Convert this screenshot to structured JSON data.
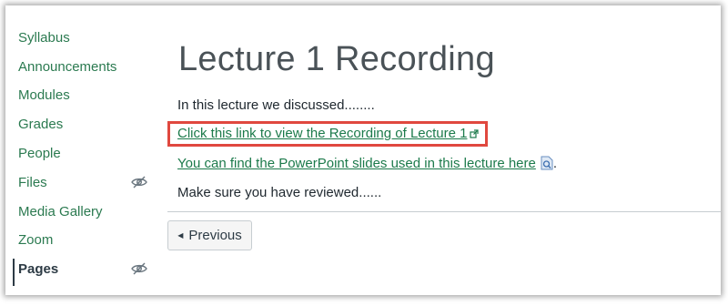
{
  "sidebar": {
    "items": [
      {
        "label": "Syllabus"
      },
      {
        "label": "Announcements"
      },
      {
        "label": "Modules"
      },
      {
        "label": "Grades"
      },
      {
        "label": "People"
      },
      {
        "label": "Files",
        "hidden_icon": "eye-slash-icon"
      },
      {
        "label": "Media Gallery"
      },
      {
        "label": "Zoom"
      },
      {
        "label": "Pages",
        "hidden_icon": "eye-slash-icon",
        "active": true
      }
    ]
  },
  "page": {
    "title": "Lecture 1 Recording",
    "intro": "In this lecture we discussed........",
    "recording_link": "Click this link to view the Recording of Lecture 1",
    "slides_link": "You can find the PowerPoint slides used in this lecture here",
    "slides_suffix": ".",
    "review": "Make sure you have reviewed......"
  },
  "footer": {
    "previous_label": "Previous"
  },
  "colors": {
    "link": "#1c7a4b",
    "highlight": "#e0483f",
    "nav_link": "#2b7a50"
  }
}
